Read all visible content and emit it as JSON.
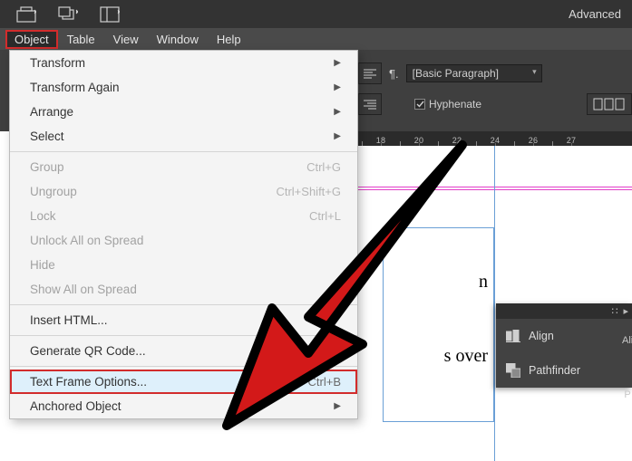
{
  "topbar": {
    "advanced_label": "Advanced"
  },
  "menubar": {
    "object": "Object",
    "table": "Table",
    "view": "View",
    "window": "Window",
    "help": "Help"
  },
  "dropdown": {
    "transform": "Transform",
    "transform_again": "Transform Again",
    "arrange": "Arrange",
    "select": "Select",
    "group": "Group",
    "group_sc": "Ctrl+G",
    "ungroup": "Ungroup",
    "ungroup_sc": "Ctrl+Shift+G",
    "lock": "Lock",
    "lock_sc": "Ctrl+L",
    "unlock": "Unlock All on Spread",
    "hide": "Hide",
    "showall": "Show All on Spread",
    "insert_html": "Insert HTML...",
    "gen_qr": "Generate QR Code...",
    "tf_options": "Text Frame Options...",
    "tf_options_sc": "Ctrl+B",
    "anchored": "Anchored Object"
  },
  "control_strip": {
    "para_style": "[Basic Paragraph]",
    "hyphenate": "Hyphenate"
  },
  "ruler": {
    "ticks": [
      "18",
      "20",
      "22",
      "24",
      "26",
      "27"
    ]
  },
  "panels": {
    "align": "Align",
    "pathfinder": "Pathfinder",
    "stub_align": "Ali",
    "stub_pathfinder": "P"
  },
  "doc_text": {
    "line1": "n",
    "line2": "s over"
  }
}
